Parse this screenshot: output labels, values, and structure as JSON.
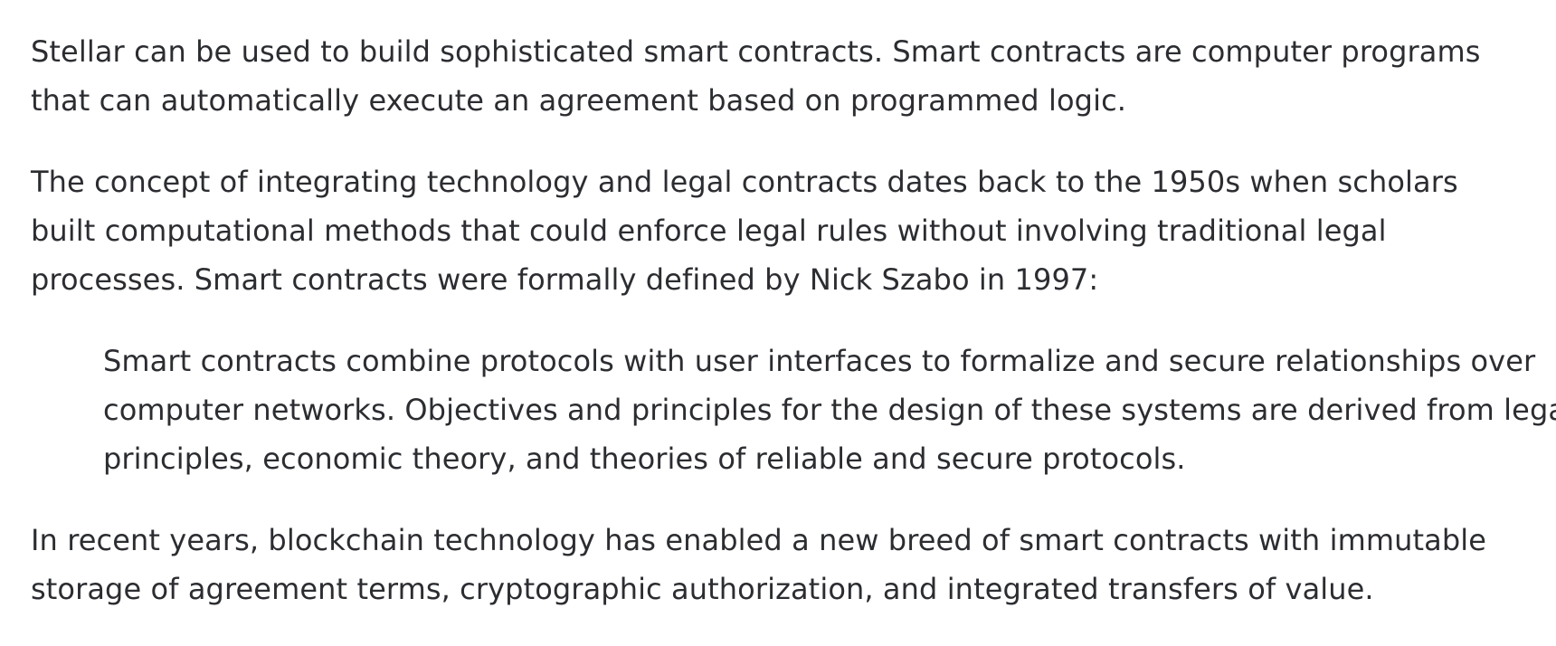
{
  "article": {
    "p1": [
      "Stellar can be used to build sophisticated smart contracts. Smart contracts are computer programs",
      "that can automatically execute an agreement based on programmed logic."
    ],
    "p2": [
      "The concept of integrating technology and legal contracts dates back to the 1950s when scholars",
      "built computational methods that could enforce legal rules without involving traditional legal",
      "processes. Smart contracts were formally defined by Nick Szabo in 1997:"
    ],
    "quote": [
      "Smart contracts combine protocols with user interfaces to formalize and secure relationships over",
      "computer networks. Objectives and principles for the design of these systems are derived from legal",
      "principles, economic theory, and theories of reliable and secure protocols."
    ],
    "p3": [
      "In recent years, blockchain technology has enabled a new breed of smart contracts with immutable",
      "storage of agreement terms, cryptographic authorization, and integrated transfers of value."
    ]
  }
}
